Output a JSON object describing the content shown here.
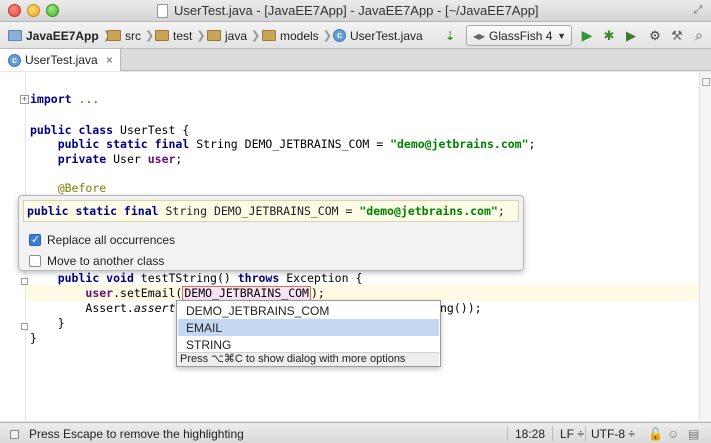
{
  "window": {
    "title": "UserTest.java - [JavaEE7App] - JavaEE7App - [~/JavaEE7App]"
  },
  "breadcrumbs": [
    "JavaEE7App",
    "src",
    "test",
    "java",
    "models",
    "UserTest.java"
  ],
  "toolbar": {
    "run_config": "GlassFish 4",
    "icons": [
      "sort-icon",
      "server-icon",
      "run-icon",
      "debug-icon",
      "coverage-icon",
      "profile-icon",
      "search-icon"
    ]
  },
  "tab": {
    "label": "UserTest.java"
  },
  "code": {
    "import_kw": "import",
    "import_dots": "...",
    "class_decl": [
      "public class ",
      "UserTest {"
    ],
    "field1": [
      "public static final ",
      "String DEMO_JETBRAINS_COM = ",
      "\"demo@jetbrains.com\"",
      ";"
    ],
    "field2": [
      "private ",
      "User ",
      "user",
      ";"
    ],
    "annotation": "@Before",
    "method_decl": [
      "public void ",
      "testT",
      "String() ",
      "throws ",
      "Exception {"
    ],
    "call_line": [
      "user",
      ".setEmail(",
      "DEMO_JETBRAINS_COM",
      ");"
    ],
    "assert_line": [
      "Assert.",
      "assert",
      "ng());"
    ],
    "close_method": "}",
    "close_class": "}"
  },
  "popup": {
    "declaration": [
      "public static final ",
      "String DEMO_JETBRAINS_COM = ",
      "\"demo@jetbrains.com\"",
      ";"
    ],
    "replace_all_label": "Replace all occurrences",
    "replace_all_checked": true,
    "move_label": "Move to another class",
    "move_checked": false
  },
  "completion": {
    "items": [
      "DEMO_JETBRAINS_COM",
      "EMAIL",
      "STRING"
    ],
    "selected_index": 1,
    "hint": "Press ⌥⌘C to show dialog with more options"
  },
  "status": {
    "message": "Press Escape to remove the highlighting",
    "position": "18:28",
    "line_separator": "LF ÷",
    "encoding": "UTF-8 ÷"
  },
  "colors": {
    "keyword": "#000080",
    "string": "#008000",
    "field": "#660e7a",
    "annotation": "#808000",
    "selection": "#c4d8f4"
  }
}
